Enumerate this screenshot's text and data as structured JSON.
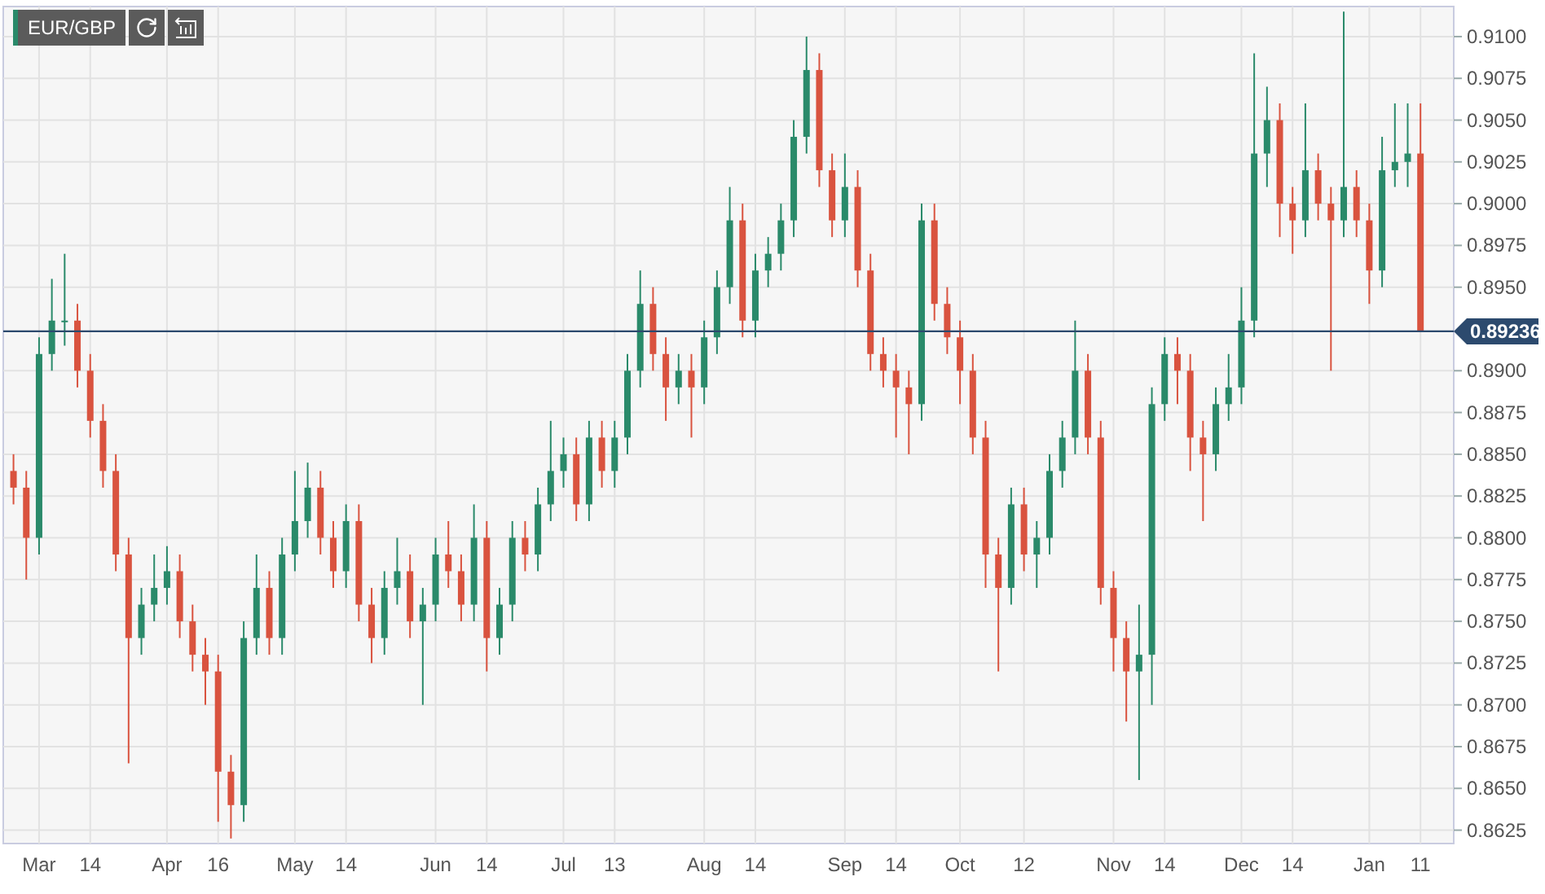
{
  "toolbar": {
    "symbol": "EUR/GBP"
  },
  "chart": {
    "chart_data": {
      "type": "candlestick",
      "grid": true,
      "categories": [
        null,
        null,
        "Mar",
        null,
        null,
        null,
        "14",
        null,
        null,
        null,
        null,
        null,
        "Apr",
        null,
        null,
        null,
        "16",
        null,
        null,
        null,
        null,
        null,
        "May",
        null,
        null,
        null,
        "14",
        null,
        null,
        null,
        null,
        null,
        null,
        "Jun",
        null,
        null,
        null,
        "14",
        null,
        null,
        null,
        null,
        null,
        "Jul",
        null,
        null,
        null,
        "13",
        null,
        null,
        null,
        null,
        null,
        null,
        "Aug",
        null,
        null,
        null,
        "14",
        null,
        null,
        null,
        null,
        null,
        null,
        "Sep",
        null,
        null,
        null,
        "14",
        null,
        null,
        null,
        null,
        "Oct",
        null,
        null,
        null,
        null,
        "12",
        null,
        null,
        null,
        null,
        null,
        null,
        "Nov",
        null,
        null,
        null,
        "14",
        null,
        null,
        null,
        null,
        null,
        "Dec",
        null,
        null,
        null,
        "14",
        null,
        null,
        null,
        null,
        null,
        "Jan",
        null,
        null,
        null,
        "11"
      ],
      "ylim": [
        0.8617,
        0.9118
      ],
      "yticks": [
        {
          "value": 0.91,
          "label": "0.9100"
        },
        {
          "value": 0.9075,
          "label": "0.9075"
        },
        {
          "value": 0.905,
          "label": "0.9050"
        },
        {
          "value": 0.9025,
          "label": "0.9025"
        },
        {
          "value": 0.9,
          "label": "0.9000"
        },
        {
          "value": 0.8975,
          "label": "0.8975"
        },
        {
          "value": 0.895,
          "label": "0.8950"
        },
        {
          "value": 0.89,
          "label": "0.8900"
        },
        {
          "value": 0.8875,
          "label": "0.8875"
        },
        {
          "value": 0.885,
          "label": "0.8850"
        },
        {
          "value": 0.8825,
          "label": "0.8825"
        },
        {
          "value": 0.88,
          "label": "0.8800"
        },
        {
          "value": 0.8775,
          "label": "0.8775"
        },
        {
          "value": 0.875,
          "label": "0.8750"
        },
        {
          "value": 0.8725,
          "label": "0.8725"
        },
        {
          "value": 0.87,
          "label": "0.8700"
        },
        {
          "value": 0.8675,
          "label": "0.8675"
        },
        {
          "value": 0.865,
          "label": "0.8650"
        },
        {
          "value": 0.8625,
          "label": "0.8625"
        }
      ],
      "ref_lines": [
        {
          "axis": "y",
          "value": 0.89236,
          "label": "0.89236"
        }
      ],
      "ohlc": [
        [
          0.884,
          0.885,
          0.882,
          0.883
        ],
        [
          0.883,
          0.884,
          0.8775,
          0.88
        ],
        [
          0.88,
          0.892,
          0.879,
          0.891
        ],
        [
          0.891,
          0.8955,
          0.89,
          0.893
        ],
        [
          0.893,
          0.897,
          0.8915,
          0.893
        ],
        [
          0.893,
          0.894,
          0.889,
          0.89
        ],
        [
          0.89,
          0.891,
          0.886,
          0.887
        ],
        [
          0.887,
          0.888,
          0.883,
          0.884
        ],
        [
          0.884,
          0.885,
          0.878,
          0.879
        ],
        [
          0.879,
          0.88,
          0.8665,
          0.874
        ],
        [
          0.874,
          0.877,
          0.873,
          0.876
        ],
        [
          0.876,
          0.879,
          0.875,
          0.877
        ],
        [
          0.877,
          0.8795,
          0.876,
          0.878
        ],
        [
          0.878,
          0.879,
          0.874,
          0.875
        ],
        [
          0.875,
          0.876,
          0.872,
          0.873
        ],
        [
          0.873,
          0.874,
          0.87,
          0.872
        ],
        [
          0.872,
          0.873,
          0.863,
          0.866
        ],
        [
          0.866,
          0.867,
          0.862,
          0.864
        ],
        [
          0.864,
          0.875,
          0.863,
          0.874
        ],
        [
          0.874,
          0.879,
          0.873,
          0.877
        ],
        [
          0.877,
          0.878,
          0.873,
          0.874
        ],
        [
          0.874,
          0.88,
          0.873,
          0.879
        ],
        [
          0.879,
          0.884,
          0.878,
          0.881
        ],
        [
          0.881,
          0.8845,
          0.88,
          0.883
        ],
        [
          0.883,
          0.884,
          0.879,
          0.88
        ],
        [
          0.88,
          0.881,
          0.877,
          0.878
        ],
        [
          0.878,
          0.882,
          0.877,
          0.881
        ],
        [
          0.881,
          0.882,
          0.875,
          0.876
        ],
        [
          0.876,
          0.877,
          0.8725,
          0.874
        ],
        [
          0.874,
          0.878,
          0.873,
          0.877
        ],
        [
          0.877,
          0.88,
          0.876,
          0.878
        ],
        [
          0.878,
          0.879,
          0.874,
          0.875
        ],
        [
          0.875,
          0.877,
          0.87,
          0.876
        ],
        [
          0.876,
          0.88,
          0.875,
          0.879
        ],
        [
          0.879,
          0.881,
          0.877,
          0.878
        ],
        [
          0.878,
          0.879,
          0.875,
          0.876
        ],
        [
          0.876,
          0.882,
          0.875,
          0.88
        ],
        [
          0.88,
          0.881,
          0.872,
          0.874
        ],
        [
          0.874,
          0.877,
          0.873,
          0.876
        ],
        [
          0.876,
          0.881,
          0.875,
          0.88
        ],
        [
          0.88,
          0.881,
          0.878,
          0.879
        ],
        [
          0.879,
          0.883,
          0.878,
          0.882
        ],
        [
          0.882,
          0.887,
          0.881,
          0.884
        ],
        [
          0.884,
          0.886,
          0.883,
          0.885
        ],
        [
          0.885,
          0.886,
          0.881,
          0.882
        ],
        [
          0.882,
          0.887,
          0.881,
          0.886
        ],
        [
          0.886,
          0.887,
          0.883,
          0.884
        ],
        [
          0.884,
          0.887,
          0.883,
          0.886
        ],
        [
          0.886,
          0.891,
          0.885,
          0.89
        ],
        [
          0.89,
          0.896,
          0.889,
          0.894
        ],
        [
          0.894,
          0.895,
          0.89,
          0.891
        ],
        [
          0.891,
          0.892,
          0.887,
          0.889
        ],
        [
          0.889,
          0.891,
          0.888,
          0.89
        ],
        [
          0.89,
          0.891,
          0.886,
          0.889
        ],
        [
          0.889,
          0.893,
          0.888,
          0.892
        ],
        [
          0.892,
          0.896,
          0.891,
          0.895
        ],
        [
          0.895,
          0.901,
          0.894,
          0.899
        ],
        [
          0.899,
          0.9,
          0.892,
          0.893
        ],
        [
          0.893,
          0.897,
          0.892,
          0.896
        ],
        [
          0.896,
          0.898,
          0.895,
          0.897
        ],
        [
          0.897,
          0.9,
          0.896,
          0.899
        ],
        [
          0.899,
          0.905,
          0.898,
          0.904
        ],
        [
          0.904,
          0.91,
          0.903,
          0.908
        ],
        [
          0.908,
          0.909,
          0.901,
          0.902
        ],
        [
          0.902,
          0.903,
          0.898,
          0.899
        ],
        [
          0.899,
          0.903,
          0.898,
          0.901
        ],
        [
          0.901,
          0.902,
          0.895,
          0.896
        ],
        [
          0.896,
          0.897,
          0.89,
          0.891
        ],
        [
          0.891,
          0.892,
          0.889,
          0.89
        ],
        [
          0.89,
          0.891,
          0.886,
          0.889
        ],
        [
          0.889,
          0.89,
          0.885,
          0.888
        ],
        [
          0.888,
          0.9,
          0.887,
          0.899
        ],
        [
          0.899,
          0.9,
          0.893,
          0.894
        ],
        [
          0.894,
          0.895,
          0.891,
          0.892
        ],
        [
          0.892,
          0.893,
          0.888,
          0.89
        ],
        [
          0.89,
          0.891,
          0.885,
          0.886
        ],
        [
          0.886,
          0.887,
          0.877,
          0.879
        ],
        [
          0.879,
          0.88,
          0.872,
          0.877
        ],
        [
          0.877,
          0.883,
          0.876,
          0.882
        ],
        [
          0.882,
          0.883,
          0.878,
          0.879
        ],
        [
          0.879,
          0.881,
          0.877,
          0.88
        ],
        [
          0.88,
          0.885,
          0.879,
          0.884
        ],
        [
          0.884,
          0.887,
          0.883,
          0.886
        ],
        [
          0.886,
          0.893,
          0.885,
          0.89
        ],
        [
          0.89,
          0.891,
          0.885,
          0.886
        ],
        [
          0.886,
          0.887,
          0.876,
          0.877
        ],
        [
          0.877,
          0.878,
          0.872,
          0.874
        ],
        [
          0.874,
          0.875,
          0.869,
          0.872
        ],
        [
          0.872,
          0.876,
          0.8655,
          0.873
        ],
        [
          0.873,
          0.889,
          0.87,
          0.888
        ],
        [
          0.888,
          0.892,
          0.887,
          0.891
        ],
        [
          0.891,
          0.892,
          0.888,
          0.89
        ],
        [
          0.89,
          0.891,
          0.884,
          0.886
        ],
        [
          0.886,
          0.887,
          0.881,
          0.885
        ],
        [
          0.885,
          0.889,
          0.884,
          0.888
        ],
        [
          0.888,
          0.891,
          0.887,
          0.889
        ],
        [
          0.889,
          0.895,
          0.888,
          0.893
        ],
        [
          0.893,
          0.909,
          0.892,
          0.903
        ],
        [
          0.903,
          0.907,
          0.901,
          0.905
        ],
        [
          0.905,
          0.906,
          0.898,
          0.9
        ],
        [
          0.9,
          0.901,
          0.897,
          0.899
        ],
        [
          0.899,
          0.906,
          0.898,
          0.902
        ],
        [
          0.902,
          0.903,
          0.899,
          0.9
        ],
        [
          0.9,
          0.901,
          0.89,
          0.899
        ],
        [
          0.899,
          0.9115,
          0.898,
          0.901
        ],
        [
          0.901,
          0.902,
          0.898,
          0.899
        ],
        [
          0.899,
          0.9,
          0.894,
          0.896
        ],
        [
          0.896,
          0.904,
          0.895,
          0.902
        ],
        [
          0.902,
          0.906,
          0.901,
          0.9025
        ],
        [
          0.9025,
          0.906,
          0.901,
          0.903
        ],
        [
          0.903,
          0.906,
          0.8924,
          0.8924
        ]
      ]
    }
  }
}
